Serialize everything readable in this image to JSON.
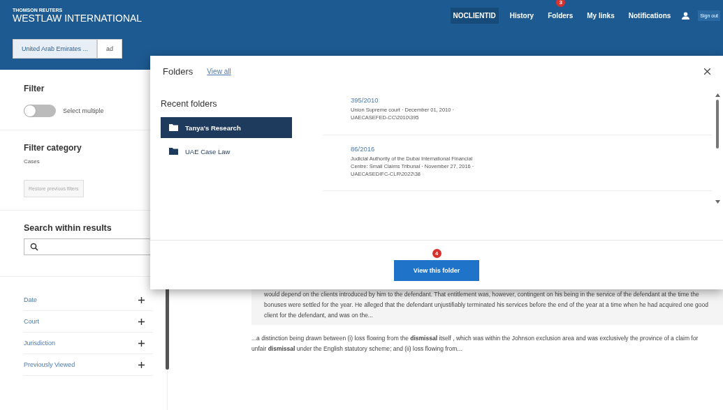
{
  "header": {
    "brand_small": "THOMSON REUTERS",
    "brand": "WESTLAW INTERNATIONAL",
    "nav": [
      {
        "label": "NOCLIENTID",
        "selected": true
      },
      {
        "label": "History",
        "selected": false
      },
      {
        "label": "Folders",
        "selected": false,
        "badge": "3"
      },
      {
        "label": "My links",
        "selected": false
      },
      {
        "label": "Notifications",
        "selected": false
      }
    ],
    "sign_out": "Sign out"
  },
  "search_tabs": [
    {
      "label": "United Arab Emirates ...",
      "selected": true
    },
    {
      "label": "ad",
      "selected": false
    }
  ],
  "sidebar": {
    "filter_title": "Filter",
    "toggle": {
      "label": "Select multiple",
      "on": false
    },
    "category_title": "Filter category",
    "category_value": "Cases",
    "restore_button": "Restore previous filters",
    "search_title": "Search within results",
    "facets": [
      {
        "label": "Date"
      },
      {
        "label": "Court"
      },
      {
        "label": "Jurisdiction"
      },
      {
        "label": "Previously Viewed"
      }
    ]
  },
  "snippets": [
    {
      "text": "would depend on the clients introduced by him to the defendant. That entitlement was, however, contingent on his being in the service of the defendant at the time the bonuses were settled for the year. He alleged that the defendant unjustifiably terminated his services before the end of the year at a time when he had acquired one good client for the defendant, and was on the...",
      "shaded": true
    },
    {
      "text": "...a distinction being drawn between (i) loss flowing from the **dismissal** itself , which was within the Johnson exclusion area and was exclusively the province of a claim for unfair **dismissal** under the English statutory scheme; and (ii) loss flowing from...",
      "shaded": false
    }
  ],
  "folders_popup": {
    "title": "Folders",
    "view_all": "View all",
    "recent_title": "Recent folders",
    "folders": [
      {
        "name": "Tanya's Research",
        "selected": true
      },
      {
        "name": "UAE Case Law",
        "selected": false
      }
    ],
    "documents": [
      {
        "title": "395/2010",
        "meta": "Union Supreme court  ·  December 01, 2010  ·  UAECASEFED-CC\\2010\\395"
      },
      {
        "title": "86/2016",
        "meta": "Judicial Authority of the Dubai International Financial Centre: Small Claims Tribunal  ·  November 27, 2016  ·  UAECASEDIFC-CLR\\2022\\38"
      }
    ],
    "badge": "4",
    "button": "View this folder"
  }
}
